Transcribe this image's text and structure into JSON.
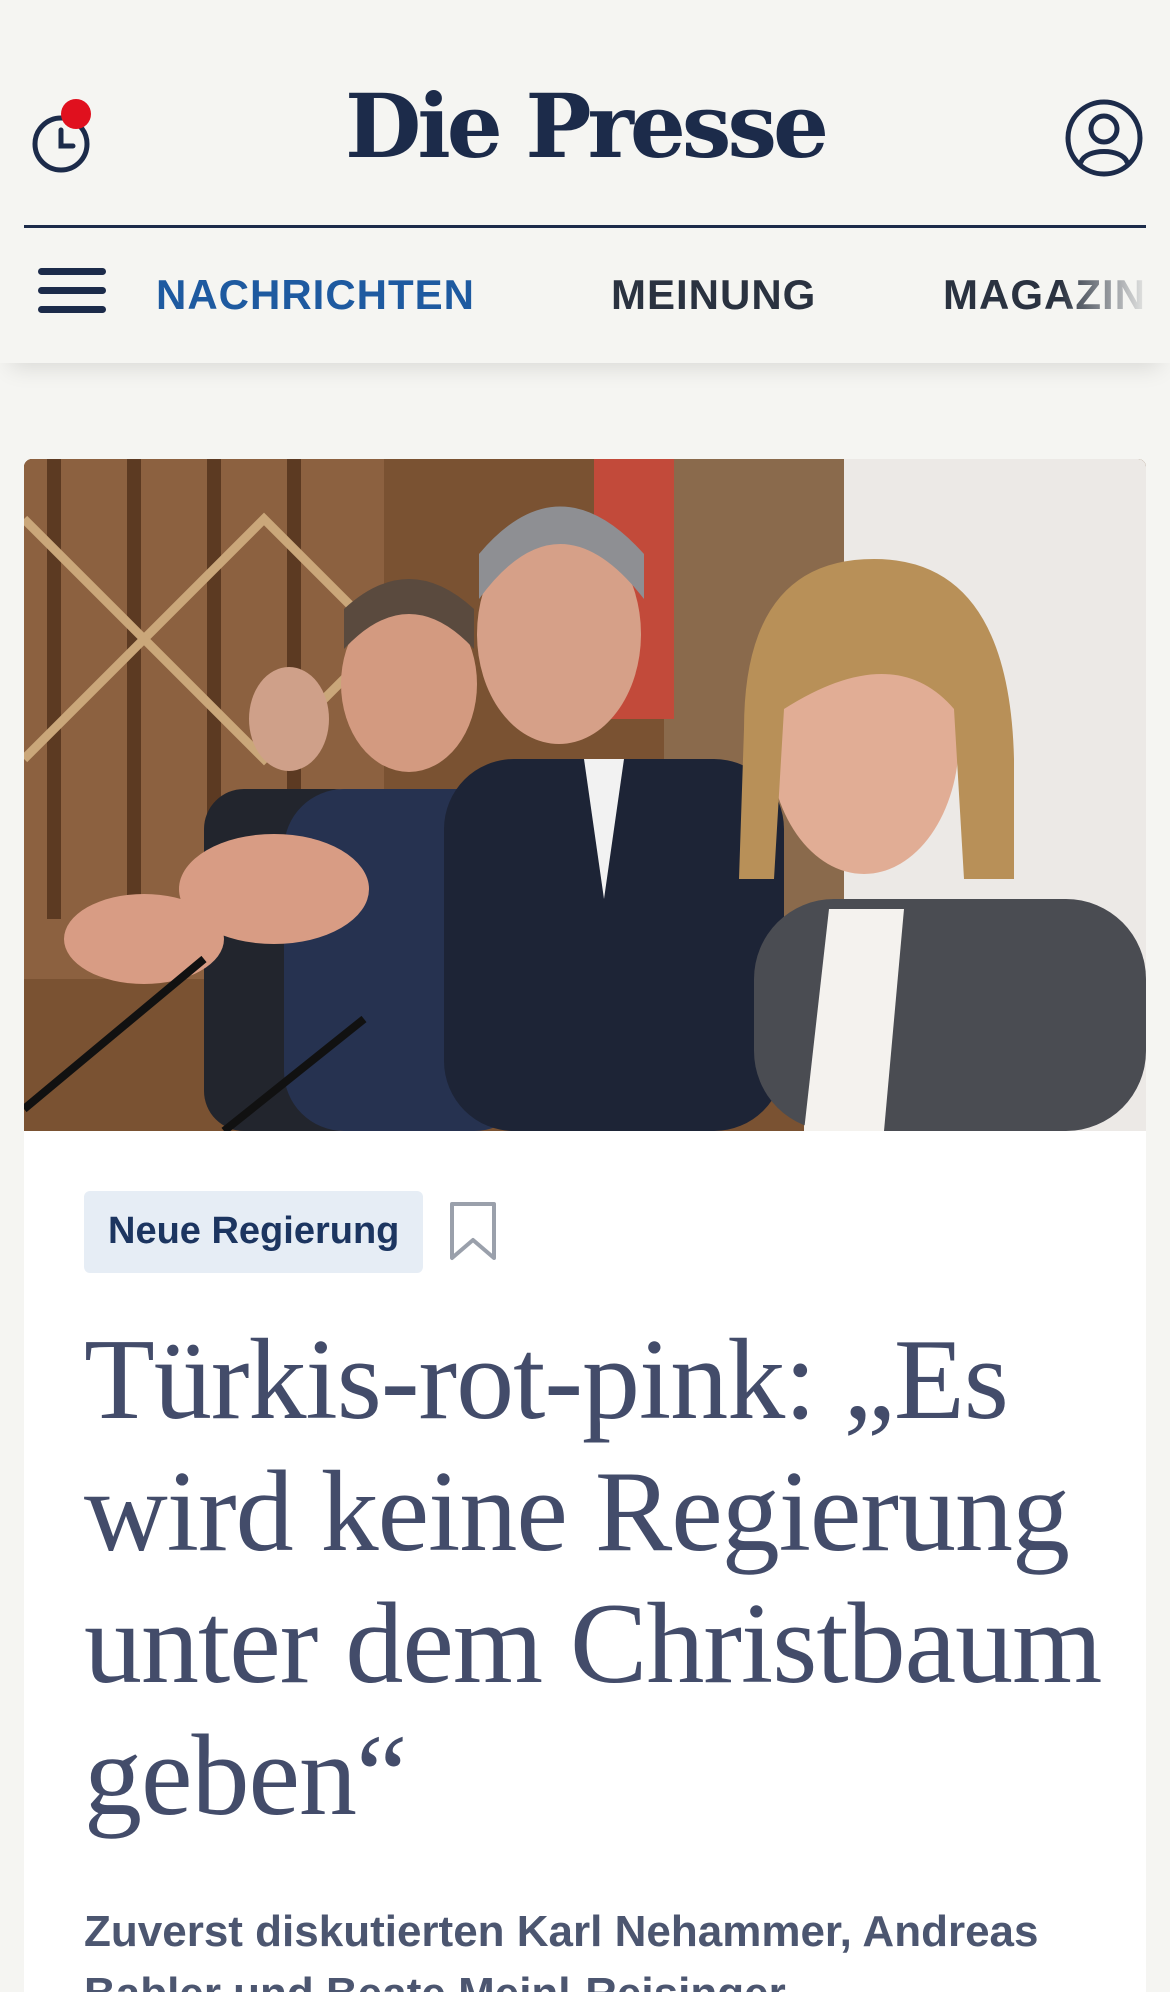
{
  "header": {
    "logo_text": "Die Presse",
    "history_icon": "clock-icon",
    "notification_dot_color": "#e0101e",
    "account_icon": "user-icon"
  },
  "nav": {
    "menu_icon": "hamburger-icon",
    "items": [
      {
        "label": "NACHRICHTEN",
        "active": true
      },
      {
        "label": "MEINUNG",
        "active": false
      },
      {
        "label": "MAGAZIN",
        "active": false
      }
    ]
  },
  "article": {
    "tag": "Neue Regierung",
    "bookmark_icon": "bookmark-icon",
    "headline": "Türkis-rot-pink: „Es wird keine Regierung unter dem Christbaum geben“",
    "lead": "Zuverst diskutierten Karl Nehammer, Andreas Babler und Beate Meinl-Reisinger"
  },
  "colors": {
    "brand_navy": "#1c2b4a",
    "nav_active": "#1e5aa0",
    "headline": "#434c6a",
    "page_background": "#f5f5f2"
  }
}
